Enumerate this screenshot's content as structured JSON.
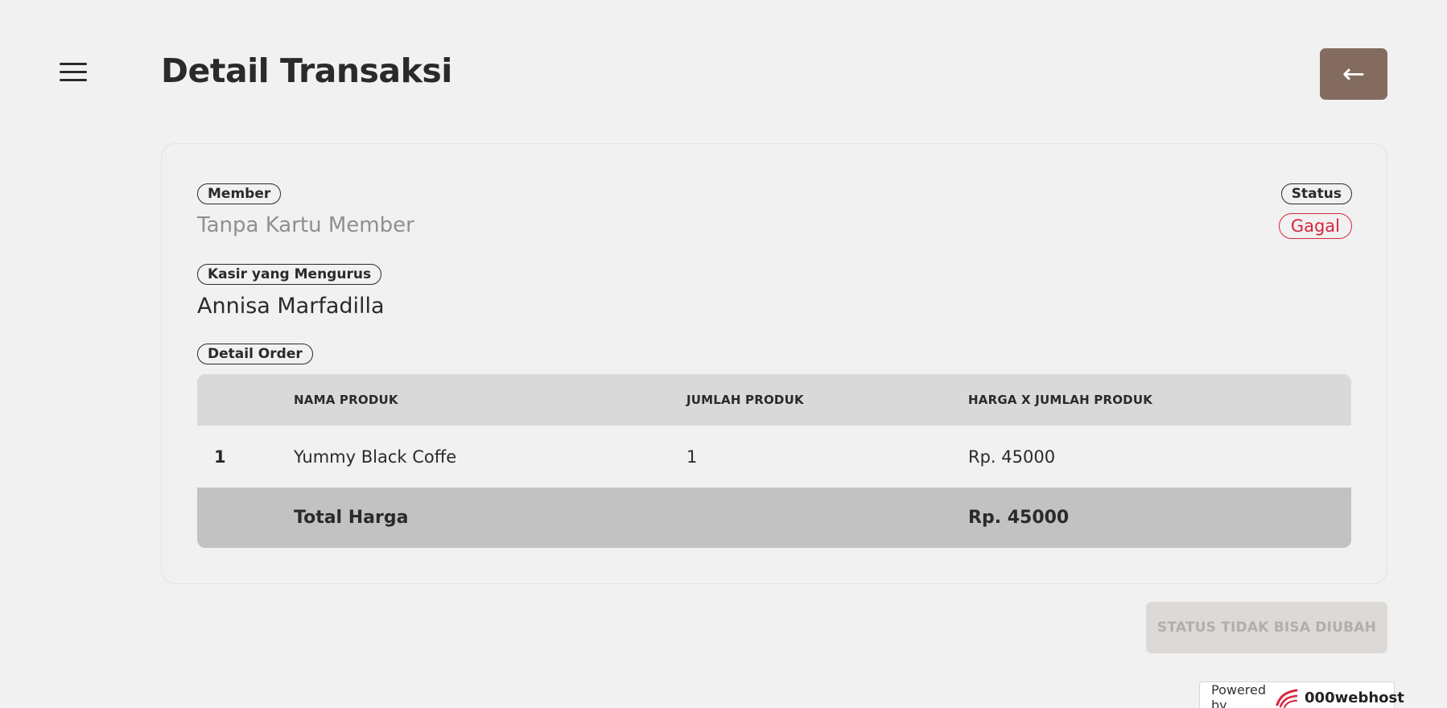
{
  "header": {
    "title": "Detail Transaksi",
    "back_icon": "←"
  },
  "card": {
    "member_label": "Member",
    "member_value": "Tanpa Kartu Member",
    "status_label": "Status",
    "status_value": "Gagal",
    "kasir_label": "Kasir yang Mengurus",
    "kasir_value": "Annisa Marfadilla",
    "detail_label": "Detail Order"
  },
  "table": {
    "headers": [
      "",
      "NAMA PRODUK",
      "JUMLAH PRODUK",
      "HARGA X JUMLAH PRODUK"
    ],
    "rows": [
      {
        "no": "1",
        "name": "Yummy Black Coffe",
        "qty": "1",
        "price": "Rp. 45000"
      }
    ],
    "total_label": "Total Harga",
    "total_value": "Rp. 45000"
  },
  "actions": {
    "status_button": "STATUS TIDAK BISA DIUBAH"
  },
  "footer": {
    "powered_by": "Powered by",
    "brand": "000webhost"
  },
  "colors": {
    "background": "#f1f1f1",
    "back_button": "#836c5f",
    "status_fail": "#d7263d",
    "table_header": "#d9d9d9",
    "table_total": "#c2c2c2"
  }
}
